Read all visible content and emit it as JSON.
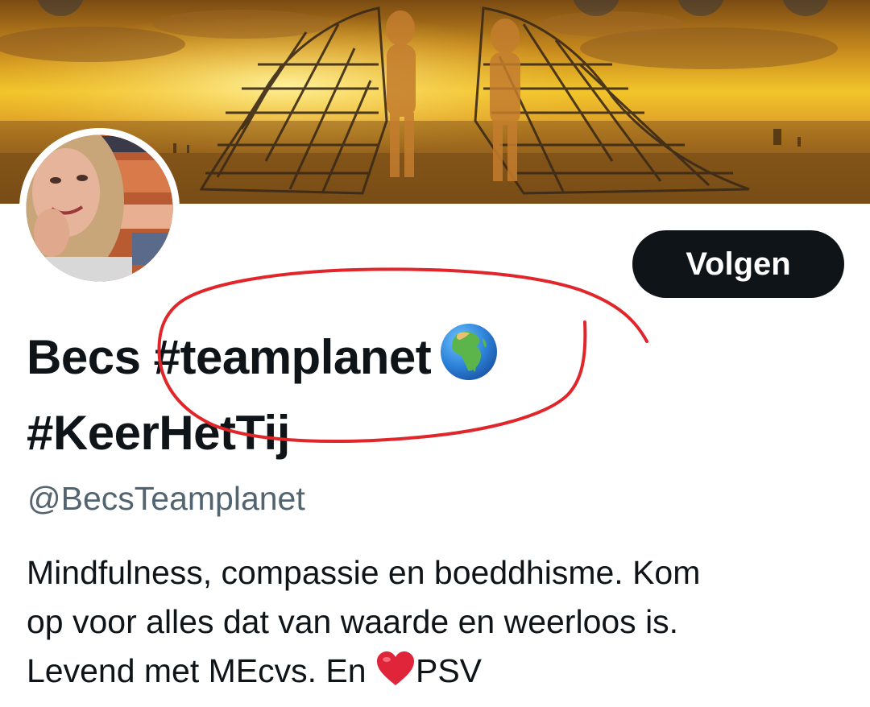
{
  "profile": {
    "follow_label": "Volgen",
    "display_name_line1": "Becs #teamplanet",
    "display_name_line2": "#KeerHetTij",
    "handle": "@BecsTeamplanet",
    "bio_line1": "Mindfulness, compassie en boeddhisme. Kom",
    "bio_line2": "op voor alles dat van waarde en weerloos is.",
    "bio_line3_before": "Levend met MEcvs. En ",
    "bio_line3_after": "PSV"
  },
  "icons": {
    "name_emoji": "globe-africa-icon",
    "bio_emoji": "red-heart-icon"
  },
  "colors": {
    "follow_button_bg": "#0f1419",
    "handle_text": "#536471",
    "annotation_circle": "#e0262a"
  }
}
